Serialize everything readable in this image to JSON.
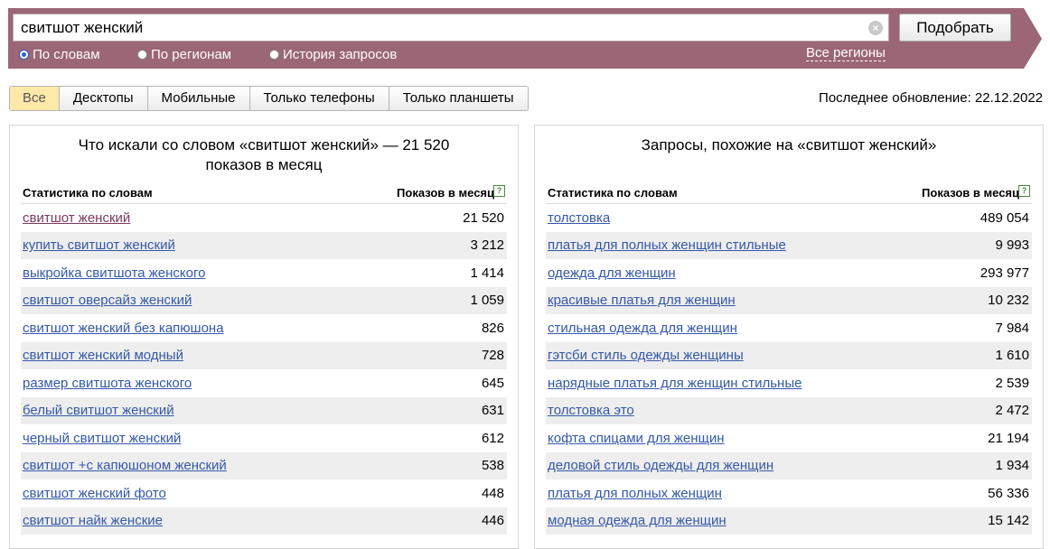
{
  "search": {
    "value": "свитшот женский",
    "clear_glyph": "×",
    "submit_label": "Подобрать"
  },
  "modes": [
    {
      "label": "По словам",
      "checked": true
    },
    {
      "label": "По регионам",
      "checked": false
    },
    {
      "label": "История запросов",
      "checked": false
    }
  ],
  "regions_link": "Все регионы",
  "device_tabs": [
    {
      "label": "Все",
      "active": true
    },
    {
      "label": "Десктопы",
      "active": false
    },
    {
      "label": "Мобильные",
      "active": false
    },
    {
      "label": "Только телефоны",
      "active": false
    },
    {
      "label": "Только планшеты",
      "active": false
    }
  ],
  "last_update": "Последнее обновление: 22.12.2022",
  "left_panel": {
    "title_line1": "Что искали со словом «свитшот женский» — 21 520",
    "title_line2": "показов в месяц",
    "col_words": "Статистика по словам",
    "col_count": "Показов в месяц",
    "help_glyph": "?",
    "rows": [
      {
        "phrase": "свитшот женский",
        "count": "21 520",
        "visited": true
      },
      {
        "phrase": "купить свитшот женский",
        "count": "3 212"
      },
      {
        "phrase": "выкройка свитшота женского",
        "count": "1 414"
      },
      {
        "phrase": "свитшот оверсайз женский",
        "count": "1 059"
      },
      {
        "phrase": "свитшот женский без капюшона",
        "count": "826"
      },
      {
        "phrase": "свитшот женский модный",
        "count": "728"
      },
      {
        "phrase": "размер свитшота женского",
        "count": "645"
      },
      {
        "phrase": "белый свитшот женский",
        "count": "631"
      },
      {
        "phrase": "черный свитшот женский",
        "count": "612"
      },
      {
        "phrase": "свитшот +с капюшоном женский",
        "count": "538"
      },
      {
        "phrase": "свитшот женский фото",
        "count": "448"
      },
      {
        "phrase": "свитшот найк женские",
        "count": "446"
      }
    ]
  },
  "right_panel": {
    "title_line1": "Запросы, похожие на «свитшот женский»",
    "col_words": "Статистика по словам",
    "col_count": "Показов в месяц",
    "help_glyph": "?",
    "rows": [
      {
        "phrase": "толстовка",
        "count": "489 054"
      },
      {
        "phrase": "платья для полных женщин стильные",
        "count": "9 993"
      },
      {
        "phrase": "одежда для женщин",
        "count": "293 977"
      },
      {
        "phrase": "красивые платья для женщин",
        "count": "10 232"
      },
      {
        "phrase": "стильная одежда для женщин",
        "count": "7 984"
      },
      {
        "phrase": "гэтсби стиль одежды женщины",
        "count": "1 610"
      },
      {
        "phrase": "нарядные платья для женщин стильные",
        "count": "2 539"
      },
      {
        "phrase": "толстовка это",
        "count": "2 472"
      },
      {
        "phrase": "кофта спицами для женщин",
        "count": "21 194"
      },
      {
        "phrase": "деловой стиль одежды для женщин",
        "count": "1 934"
      },
      {
        "phrase": "платья для полных женщин",
        "count": "56 336"
      },
      {
        "phrase": "модная одежда для женщин",
        "count": "15 142"
      }
    ]
  }
}
